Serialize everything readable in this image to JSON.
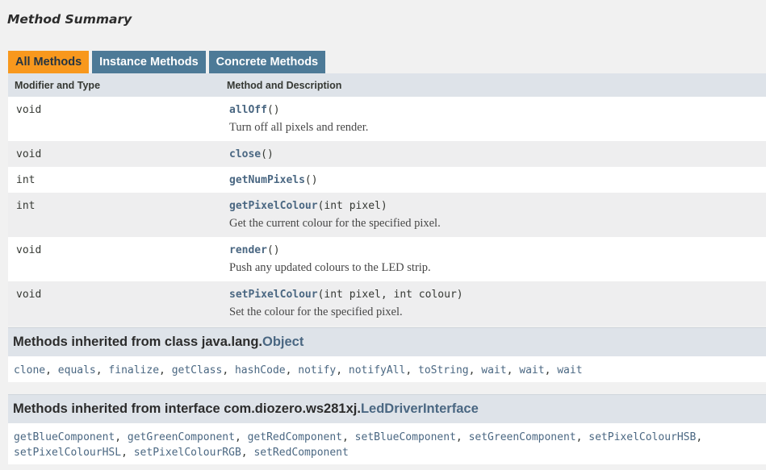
{
  "page": {
    "title": "Method Summary"
  },
  "tabs": [
    {
      "label": "All Methods",
      "active": true
    },
    {
      "label": "Instance Methods",
      "active": false
    },
    {
      "label": "Concrete Methods",
      "active": false
    }
  ],
  "table": {
    "headers": {
      "modifier": "Modifier and Type",
      "method": "Method and Description"
    },
    "rows": [
      {
        "type": "void",
        "name": "allOff",
        "params": "()",
        "description": "Turn off all pixels and render."
      },
      {
        "type": "void",
        "name": "close",
        "params": "()",
        "description": ""
      },
      {
        "type": "int",
        "name": "getNumPixels",
        "params": "()",
        "description": ""
      },
      {
        "type": "int",
        "name": "getPixelColour",
        "params": "(int pixel)",
        "description": "Get the current colour for the specified pixel."
      },
      {
        "type": "void",
        "name": "render",
        "params": "()",
        "description": "Push any updated colours to the LED strip."
      },
      {
        "type": "void",
        "name": "setPixelColour",
        "params": "(int pixel, int colour)",
        "description": "Set the colour for the specified pixel."
      }
    ]
  },
  "inherited_object": {
    "prefix": "Methods inherited from class java.lang.",
    "link": "Object",
    "methods": [
      "clone",
      "equals",
      "finalize",
      "getClass",
      "hashCode",
      "notify",
      "notifyAll",
      "toString",
      "wait",
      "wait",
      "wait"
    ]
  },
  "inherited_interface": {
    "prefix": "Methods inherited from interface com.diozero.ws281xj.",
    "link": "LedDriverInterface",
    "methods": [
      "getBlueComponent",
      "getGreenComponent",
      "getRedComponent",
      "setBlueComponent",
      "setGreenComponent",
      "setPixelColourHSB",
      "setPixelColourHSL",
      "setPixelColourRGB",
      "setRedComponent"
    ]
  },
  "colors": {
    "tab_active": "#f8981d",
    "tab_inactive": "#4d7a97",
    "link": "#4a6782",
    "header_bg": "#dee3e9"
  }
}
